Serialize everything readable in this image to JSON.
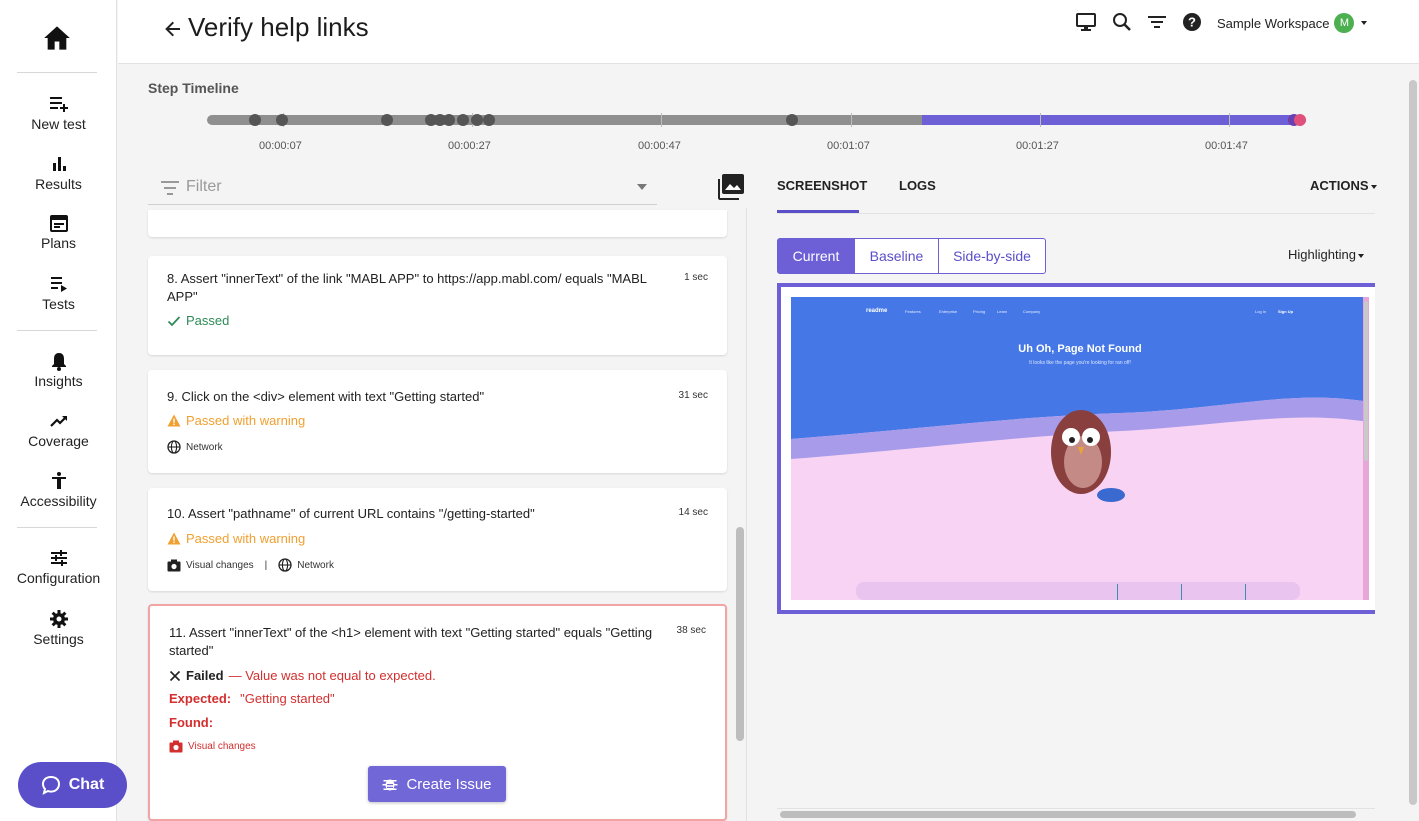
{
  "sidebar": {
    "items": [
      {
        "label": "New test",
        "icon": "playlist-add-icon"
      },
      {
        "label": "Results",
        "icon": "bar-chart-icon"
      },
      {
        "label": "Plans",
        "icon": "calendar-icon"
      },
      {
        "label": "Tests",
        "icon": "playlist-play-icon"
      },
      {
        "label": "Insights",
        "icon": "bell-icon"
      },
      {
        "label": "Coverage",
        "icon": "trending-up-icon"
      },
      {
        "label": "Accessibility",
        "icon": "accessibility-icon"
      },
      {
        "label": "Configuration",
        "icon": "tune-icon"
      },
      {
        "label": "Settings",
        "icon": "gear-icon"
      }
    ],
    "chat_label": "Chat"
  },
  "header": {
    "title": "Verify help links",
    "workspace": "Sample Workspace",
    "avatar_initial": "M"
  },
  "timeline": {
    "label": "Step Timeline",
    "times": [
      "00:00:07",
      "00:00:27",
      "00:00:47",
      "00:01:07",
      "00:01:27",
      "00:01:47"
    ]
  },
  "filter": {
    "placeholder": "Filter"
  },
  "steps": [
    {
      "title": "8. Assert \"innerText\" of the link \"MABL APP\" to https://app.mabl.com/ equals \"MABL APP\"",
      "duration": "1 sec",
      "status": "Passed"
    },
    {
      "title": "9. Click on the <div> element with text \"Getting started\"",
      "duration": "31 sec",
      "status": "Passed with warning",
      "meta": [
        "Network"
      ]
    },
    {
      "title": "10. Assert \"pathname\" of current URL contains \"/getting-started\"",
      "duration": "14 sec",
      "status": "Passed with warning",
      "meta": [
        "Visual changes",
        "|",
        "Network"
      ]
    },
    {
      "title": "11. Assert \"innerText\" of the <h1> element with text \"Getting started\" equals \"Getting started\"",
      "duration": "38 sec",
      "status": "Failed",
      "status_detail": "— Value was not equal to expected.",
      "expected_label": "Expected:",
      "expected_value": "\"Getting started\"",
      "found_label": "Found:",
      "meta": [
        "Visual changes"
      ],
      "button": "Create Issue"
    }
  ],
  "panel": {
    "tabs": [
      "SCREENSHOT",
      "LOGS"
    ],
    "actions": "ACTIONS",
    "views": [
      "Current",
      "Baseline",
      "Side-by-side"
    ],
    "highlighting": "Highlighting"
  },
  "screenshot": {
    "brand": "readme",
    "nav": [
      "Features",
      "Enterprise",
      "Pricing",
      "Learn",
      "Company"
    ],
    "login": "Log In",
    "signup": "Sign Up",
    "heading": "Uh Oh, Page Not Found",
    "subheading": "It looks like the page you're looking for ran off!"
  },
  "colors": {
    "accent": "#6d5fd6",
    "pass": "#2e8b57",
    "warn": "#f0a030",
    "fail": "#d32f2f"
  }
}
